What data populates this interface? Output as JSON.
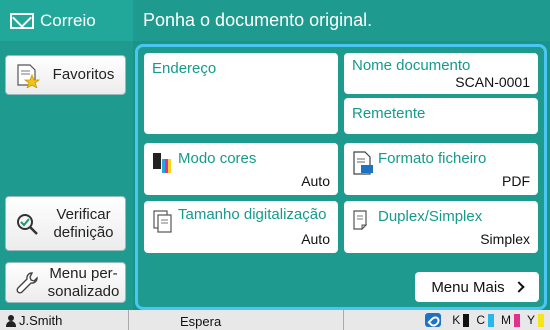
{
  "app": {
    "mode_title": "Correio",
    "instruction": "Ponha o documento original."
  },
  "sidebar": {
    "favorites_label": "Favoritos",
    "check_settings_label": "Verificar definição",
    "custom_menu_label": "Menu personalizado"
  },
  "tiles": {
    "address": {
      "label": "Endereço"
    },
    "document_name": {
      "label": "Nome documento",
      "value": "SCAN-0001"
    },
    "sender": {
      "label": "Remetente"
    },
    "color_mode": {
      "label": "Modo cores",
      "value": "Auto"
    },
    "file_format": {
      "label": "Formato ficheiro",
      "value": "PDF"
    },
    "scan_size": {
      "label": "Tamanho digitalização",
      "value": "Auto"
    },
    "duplex": {
      "label": "Duplex/Simplex",
      "value": "Simplex"
    }
  },
  "more_button": {
    "label": "Menu Mais"
  },
  "status": {
    "user": "J.Smith",
    "state": "Espera",
    "ink": {
      "k_label": "K",
      "c_label": "C",
      "m_label": "M",
      "y_label": "Y",
      "k_color": "#111111",
      "c_color": "#29b6e8",
      "m_color": "#e0318f",
      "y_color": "#f5e61c"
    }
  },
  "colors": {
    "header": "#1f9a8e",
    "panel_border": "#49c6f2",
    "tile_label": "#169a8c"
  }
}
